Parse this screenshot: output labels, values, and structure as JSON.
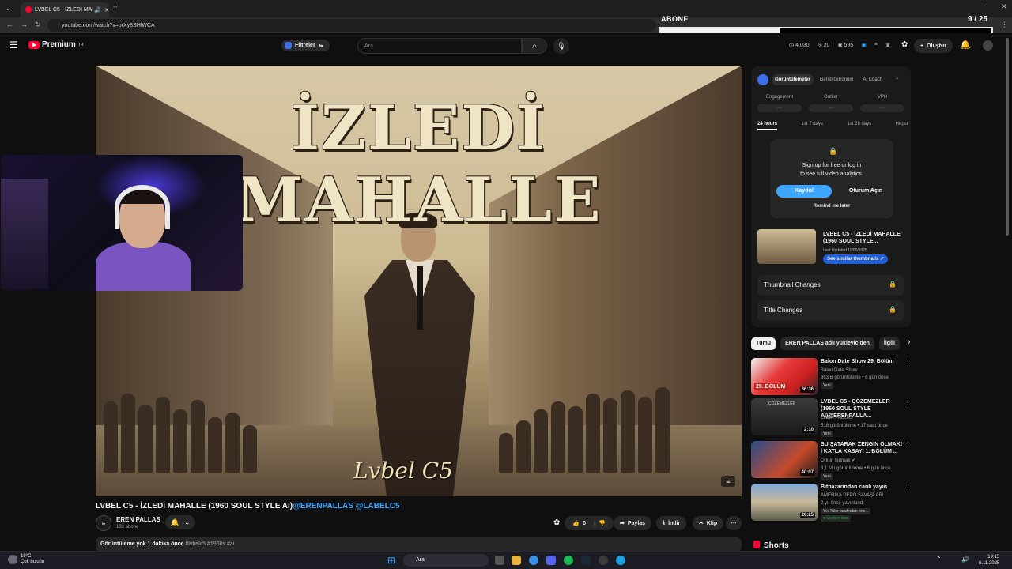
{
  "browser": {
    "tab_title": "LVBEL C5 - İZLEDİ MAHALLE",
    "url": "youtube.com/watch?v=orXy8SHlWCA"
  },
  "overlay": {
    "label": "ABONE",
    "count": "9 / 25",
    "progress": 0.36
  },
  "header": {
    "logo": "Premium",
    "logo_sup": "TR",
    "filters": "Filtreler",
    "search_placeholder": "Ara",
    "stat_views": "4,030",
    "stat_a": "20",
    "stat_b": "595",
    "create": "Oluştur"
  },
  "video": {
    "overlay_title": "İZLEDİ MAHALLE",
    "overlay_signature": "Lvbel C5",
    "title": "LVBEL C5 - İZLEDİ MAHALLE (1960 SOUL STYLE AI)",
    "title_tags": "@ERENPALLAS @LABELC5",
    "channel": "EREN PALLAS",
    "subscribers": "133 abone",
    "likes": "0",
    "share": "Paylaş",
    "download": "İndir",
    "clip": "Klip",
    "desc_views": "Görüntüleme yok",
    "desc_time": "1 dakika önce",
    "desc_tags": "#lvbelc5 #1960s #ai"
  },
  "panel": {
    "tabs": [
      "Görüntülemeler",
      "Genel Görünüm",
      "AI Coach"
    ],
    "metrics": [
      "Engagement",
      "Outlier",
      "VPH"
    ],
    "metric_value": "----",
    "ranges": [
      "24 hours",
      "1st 7 days",
      "1st 28 days",
      "Hepsi"
    ],
    "lock_msg_1": "Sign up for",
    "lock_free": "free",
    "lock_msg_2": "or log in",
    "lock_msg_3": "to see full video analytics.",
    "signup": "Kaydol",
    "login": "Oturum Açın",
    "remind": "Remind me later",
    "thumb_title": "LVBEL C5 - İZLEDİ MAHALLE (1960 SOUL STYLE...",
    "thumb_updated": "Last Updated 11/06/2025",
    "similar": "See similar thumbnails",
    "thumbnail_changes": "Thumbnail Changes",
    "title_changes": "Title Changes"
  },
  "chips": [
    "Tümü",
    "EREN PALLAS adlı yükleyiciden",
    "İlgili"
  ],
  "recommendations": [
    {
      "title": "Balon Date Show 29. Bölüm",
      "channel": "Balon Date Show",
      "meta": "363 B görüntüleme • 6 gün önce",
      "badge": "Yeni",
      "duration": "36:36",
      "thumb_label": "29. BÖLÜM"
    },
    {
      "title": "LVBEL C5 - ÇÖZEMEZLER (1960 SOUL STYLE AI)@ERENPALLA...",
      "channel": "EREN PALLAS",
      "meta": "518 görüntüleme • 17 saat önce",
      "badge": "Yeni",
      "duration": "2:10",
      "thumb_label": "ÇÖZEMEZLER"
    },
    {
      "title": "SU ŞATARAK ZENGİN OLMAK! İ KATLA KASAYI 1. BÖLÜM ...",
      "channel": "Orkun Işıtmak",
      "meta": "3,1 Mn görüntüleme • 6 gün önce",
      "badge": "Yeni",
      "duration": "40:07"
    },
    {
      "title": "Bitpazarından canlı yayın",
      "channel": "AMERİKA DEPO SAVAŞLARI",
      "meta": "2 yıl önce yayınlandı",
      "badge": "YouTube tarafından öne...",
      "member": "Üyelere özel",
      "duration": "26:25"
    }
  ],
  "shorts": "Shorts",
  "taskbar": {
    "temp": "19°C",
    "weather": "Çok bulutlu",
    "search": "Ara",
    "time": "19:15",
    "date": "6.11.2025"
  }
}
